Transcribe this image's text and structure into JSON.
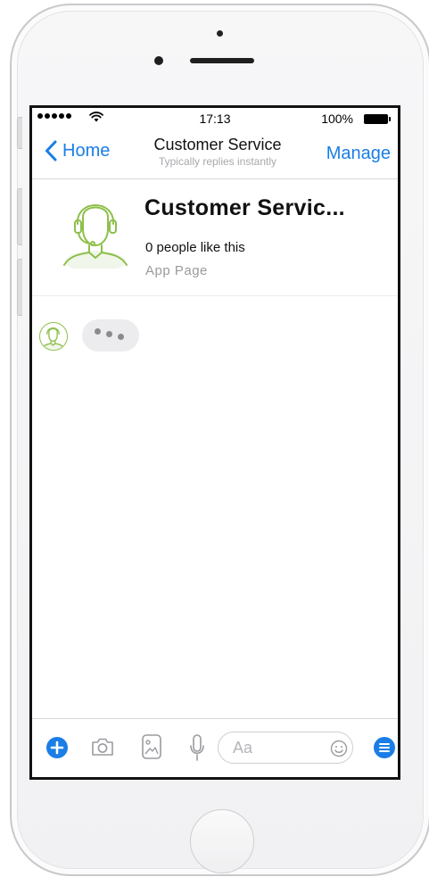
{
  "status_bar": {
    "time": "17:13",
    "battery": "100%",
    "icons": [
      "signal-dots-icon",
      "wifi-icon",
      "battery-icon"
    ]
  },
  "nav": {
    "back_label": "Home",
    "title": "Customer Service",
    "subtitle": "Typically replies instantly",
    "manage_label": "Manage"
  },
  "page_header": {
    "name": "Customer Servic...",
    "likes": "0 people like this",
    "category": "App Page",
    "avatar_icon": "headset-agent-icon"
  },
  "conversation": {
    "typing_indicator": true,
    "sender_avatar_icon": "headset-agent-icon"
  },
  "composer": {
    "input_placeholder": "Aa",
    "icons": [
      "plus-icon",
      "camera-icon",
      "photo-icon",
      "microphone-icon",
      "emoji-icon",
      "menu-icon"
    ]
  },
  "colors": {
    "accent_blue": "#1a7ee6",
    "avatar_green": "#8dbf4a",
    "avatar_bg": "#f1f6ea"
  }
}
